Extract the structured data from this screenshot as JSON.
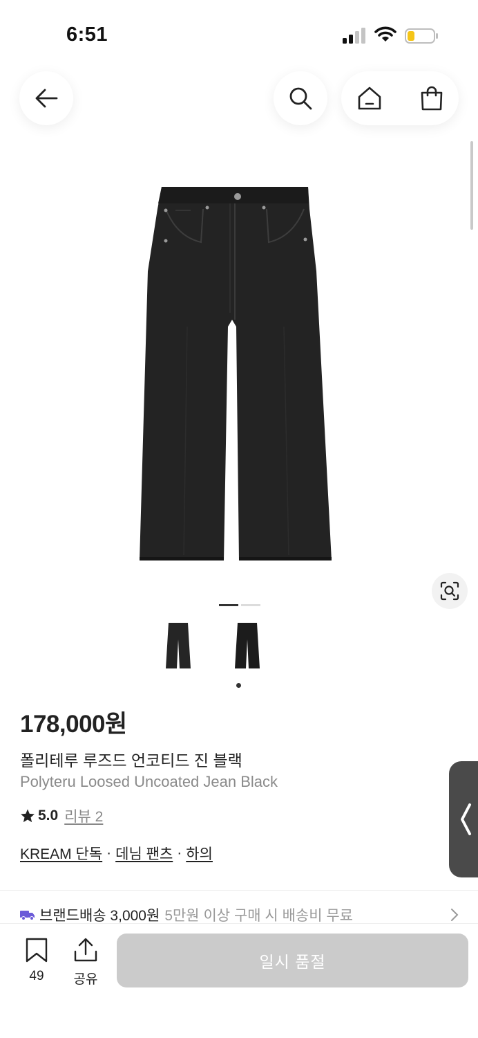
{
  "status_bar": {
    "time": "6:51"
  },
  "product": {
    "price": "178,000원",
    "name_ko": "폴리테루 루즈드 언코티드 진 블랙",
    "name_en": "Polyteru Loosed Uncoated Jean Black",
    "rating": "5.0",
    "review_label": "리뷰 2",
    "image_count": 2,
    "active_image_index": 1
  },
  "breadcrumbs": [
    {
      "label": "KREAM 단독"
    },
    {
      "label": "데님 팬츠"
    },
    {
      "label": "하의"
    }
  ],
  "breadcrumb_separator": "·",
  "shipping": {
    "title": "브랜드배송 3,000원",
    "note": "5만원 이상 구매 시 배송비 무료"
  },
  "bottom_bar": {
    "bookmark_count": "49",
    "share_label": "공유",
    "soldout_label": "일시 품절"
  },
  "colors": {
    "accent_truck": "#6b5bd8",
    "soldout_bg": "#cbcbcb",
    "denim": "#222222"
  },
  "icons": [
    "back-arrow-icon",
    "search-icon",
    "home-icon",
    "shopping-bag-icon",
    "image-search-icon",
    "star-icon",
    "truck-icon",
    "chevron-right-icon",
    "bookmark-icon",
    "share-icon"
  ]
}
